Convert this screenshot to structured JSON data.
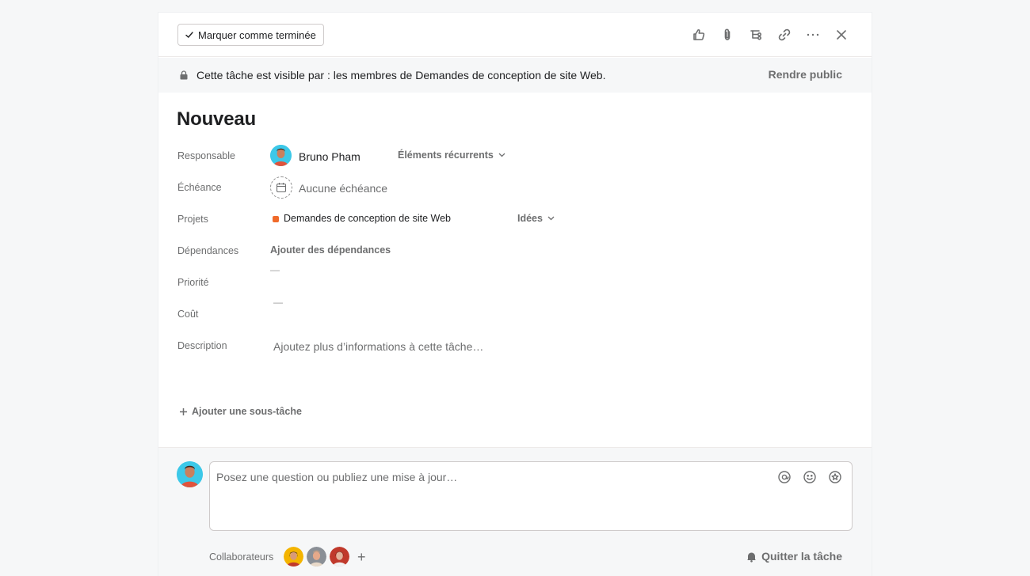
{
  "toolbar": {
    "mark_complete_label": "Marquer comme terminée",
    "icons": [
      "thumbs-up-icon",
      "paperclip-icon",
      "subtask-icon",
      "link-icon",
      "more-icon",
      "close-icon"
    ]
  },
  "banner": {
    "text": "Cette tâche est visible par : les membres de Demandes de conception de site Web.",
    "action_label": "Rendre public"
  },
  "task": {
    "title": "Nouveau"
  },
  "fields": {
    "assignee_label": "Responsable",
    "assignee_name": "Bruno Pham",
    "recurring_label": "Éléments récurrents",
    "due_label": "Échéance",
    "due_value": "Aucune échéance",
    "projects_label": "Projets",
    "project_name": "Demandes de conception de site Web",
    "project_color": "#f06a2a",
    "section_name": "Idées",
    "dependencies_label": "Dépendances",
    "dependencies_action": "Ajouter des dépendances",
    "priority_label": "Priorité",
    "priority_value": "—",
    "cost_label": "Coût",
    "cost_value": "—",
    "description_label": "Description",
    "description_placeholder": "Ajoutez plus d’informations à cette tâche…"
  },
  "subtask": {
    "add_label": "Ajouter une sous-tâche"
  },
  "comment": {
    "placeholder": "Posez une question ou publiez une mise à jour…",
    "icons": [
      "mention-icon",
      "emoji-icon",
      "star-icon"
    ]
  },
  "collaborators": {
    "label": "Collaborateurs",
    "count": 3,
    "leave_label": "Quitter la tâche"
  },
  "colors": {
    "accent_avatar": "#3cc8e8",
    "text_primary": "#1e1f21",
    "text_secondary": "#6d6e6f"
  }
}
